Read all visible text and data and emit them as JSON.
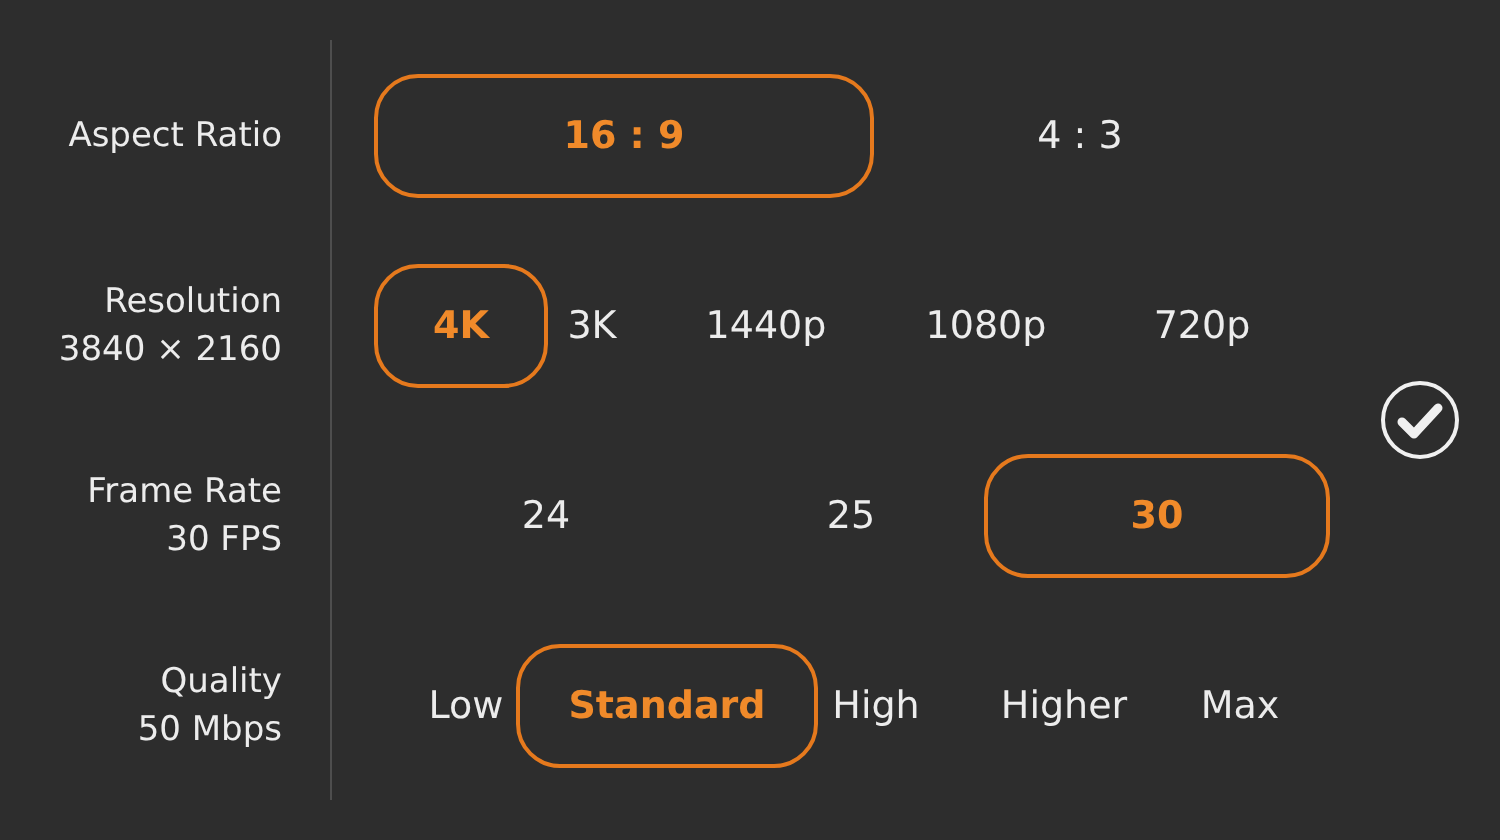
{
  "settings": [
    {
      "label": "Aspect Ratio",
      "options": [
        {
          "label": "16 : 9",
          "selected": true
        },
        {
          "label": "4 : 3",
          "selected": false
        }
      ]
    },
    {
      "label": "Resolution",
      "value": "3840 × 2160",
      "options": [
        {
          "label": "4K",
          "selected": true
        },
        {
          "label": "3K",
          "selected": false
        },
        {
          "label": "1440p",
          "selected": false
        },
        {
          "label": "1080p",
          "selected": false
        },
        {
          "label": "720p",
          "selected": false
        }
      ]
    },
    {
      "label": "Frame Rate",
      "value": "30 FPS",
      "options": [
        {
          "label": "24",
          "selected": false
        },
        {
          "label": "25",
          "selected": false
        },
        {
          "label": "30",
          "selected": true
        }
      ]
    },
    {
      "label": "Quality",
      "value": "50 Mbps",
      "options": [
        {
          "label": "Low",
          "selected": false
        },
        {
          "label": "Standard",
          "selected": true
        },
        {
          "label": "High",
          "selected": false
        },
        {
          "label": "Higher",
          "selected": false
        },
        {
          "label": "Max",
          "selected": false
        }
      ]
    }
  ]
}
